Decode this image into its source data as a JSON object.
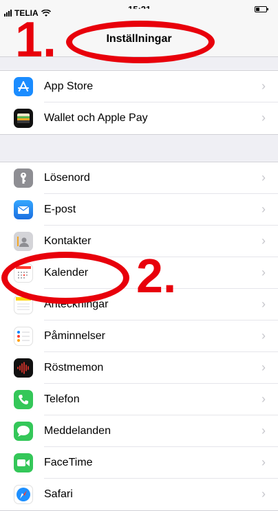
{
  "status": {
    "carrier": "TELIA",
    "time": "15:21"
  },
  "nav": {
    "title": "Inställningar"
  },
  "groups": [
    {
      "items": [
        {
          "label": "App Store",
          "icon": "app-store-icon",
          "color": "#1a8cff"
        },
        {
          "label": "Wallet och Apple Pay",
          "icon": "wallet-icon",
          "color": "#111111"
        }
      ]
    },
    {
      "items": [
        {
          "label": "Lösenord",
          "icon": "key-icon",
          "color": "#8e8e93"
        },
        {
          "label": "E-post",
          "icon": "mail-icon",
          "color": "#1e90ff"
        },
        {
          "label": "Kontakter",
          "icon": "contacts-icon",
          "color": "#c9c9cf"
        },
        {
          "label": "Kalender",
          "icon": "calendar-icon",
          "color": "#ffffff"
        },
        {
          "label": "Anteckningar",
          "icon": "notes-icon",
          "color": "#ffffff"
        },
        {
          "label": "Påminnelser",
          "icon": "reminders-icon",
          "color": "#ffffff"
        },
        {
          "label": "Röstmemon",
          "icon": "voice-memos-icon",
          "color": "#111111"
        },
        {
          "label": "Telefon",
          "icon": "phone-icon",
          "color": "#34c759"
        },
        {
          "label": "Meddelanden",
          "icon": "messages-icon",
          "color": "#34c759"
        },
        {
          "label": "FaceTime",
          "icon": "facetime-icon",
          "color": "#34c759"
        },
        {
          "label": "Safari",
          "icon": "safari-icon",
          "color": "#1e90ff"
        }
      ]
    }
  ],
  "annotations": {
    "step1": "1.",
    "step2": "2.",
    "accent": "#e8000b"
  }
}
